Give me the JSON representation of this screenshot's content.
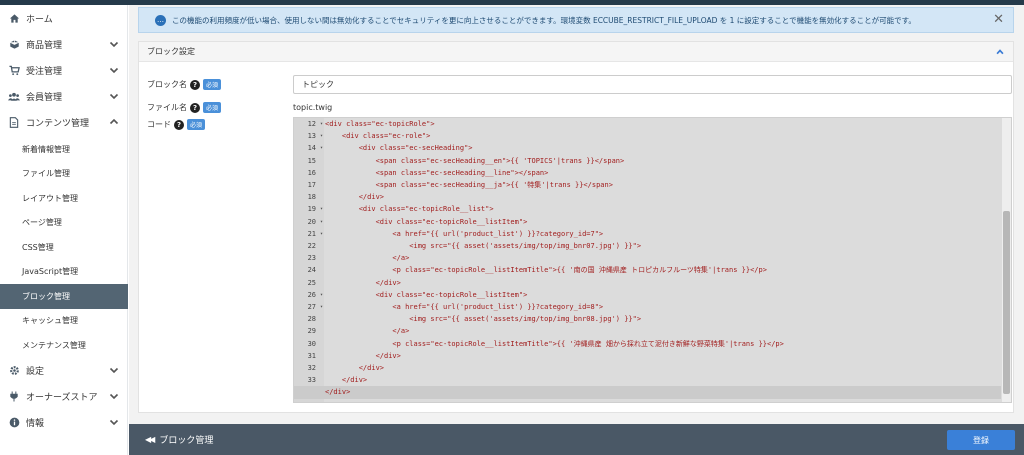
{
  "sidebar": {
    "items": [
      {
        "label": "ホーム",
        "icon": "home-icon"
      },
      {
        "label": "商品管理",
        "icon": "box-icon"
      },
      {
        "label": "受注管理",
        "icon": "cart-icon"
      },
      {
        "label": "会員管理",
        "icon": "users-icon"
      },
      {
        "label": "コンテンツ管理",
        "icon": "file-icon"
      }
    ],
    "sub_items": [
      "新着情報管理",
      "ファイル管理",
      "レイアウト管理",
      "ページ管理",
      "CSS管理",
      "JavaScript管理",
      "ブロック管理",
      "キャッシュ管理",
      "メンテナンス管理"
    ],
    "bottom_items": [
      {
        "label": "設定",
        "icon": "gear-icon"
      },
      {
        "label": "オーナーズストア",
        "icon": "plug-icon"
      },
      {
        "label": "情報",
        "icon": "info-icon"
      }
    ]
  },
  "alert": {
    "text": "この機能の利用頻度が低い場合、使用しない間は無効化することでセキュリティを更に向上させることができます。環境変数 ECCUBE_RESTRICT_FILE_UPLOAD を 1 に設定することで機能を無効化することが可能です。"
  },
  "card": {
    "title": "ブロック設定",
    "name_label": "ブロック名",
    "name_value": "トピック",
    "file_label": "ファイル名",
    "file_value": "topic.twig",
    "code_label": "コード",
    "required_badge": "必須"
  },
  "editor": {
    "line_numbers": [
      "12",
      "13",
      "14",
      "15",
      "16",
      "17",
      "18",
      "19",
      "20",
      "21",
      "22",
      "23",
      "24",
      "25",
      "26",
      "27",
      "28",
      "29",
      "30",
      "31",
      "32",
      "33",
      "34"
    ],
    "lines": [
      "<div class=\"ec-topicRole\">",
      "    <div class=\"ec-role\">",
      "        <div class=\"ec-secHeading\">",
      "            <span class=\"ec-secHeading__en\">{{ 'TOPICS'|trans }}</span>",
      "            <span class=\"ec-secHeading__line\"></span>",
      "            <span class=\"ec-secHeading__ja\">{{ '特集'|trans }}</span>",
      "        </div>",
      "        <div class=\"ec-topicRole__list\">",
      "            <div class=\"ec-topicRole__listItem\">",
      "                <a href=\"{{ url('product_list') }}?category_id=7\">",
      "                    <img src=\"{{ asset('assets/img/top/img_bnr07.jpg') }}\">",
      "                </a>",
      "                <p class=\"ec-topicRole__listItemTitle\">{{ '南の国 沖縄県産 トロピカルフルーツ特集'|trans }}</p>",
      "            </div>",
      "            <div class=\"ec-topicRole__listItem\">",
      "                <a href=\"{{ url('product_list') }}?category_id=8\">",
      "                    <img src=\"{{ asset('assets/img/top/img_bnr08.jpg') }}\">",
      "                </a>",
      "                <p class=\"ec-topicRole__listItemTitle\">{{ '沖縄県産 畑から採れ立て泥付き新鮮な野菜特集'|trans }}</p>",
      "            </div>",
      "        </div>",
      "    </div>",
      "</div>"
    ]
  },
  "footer": {
    "back_label": "ブロック管理",
    "save_label": "登録"
  }
}
